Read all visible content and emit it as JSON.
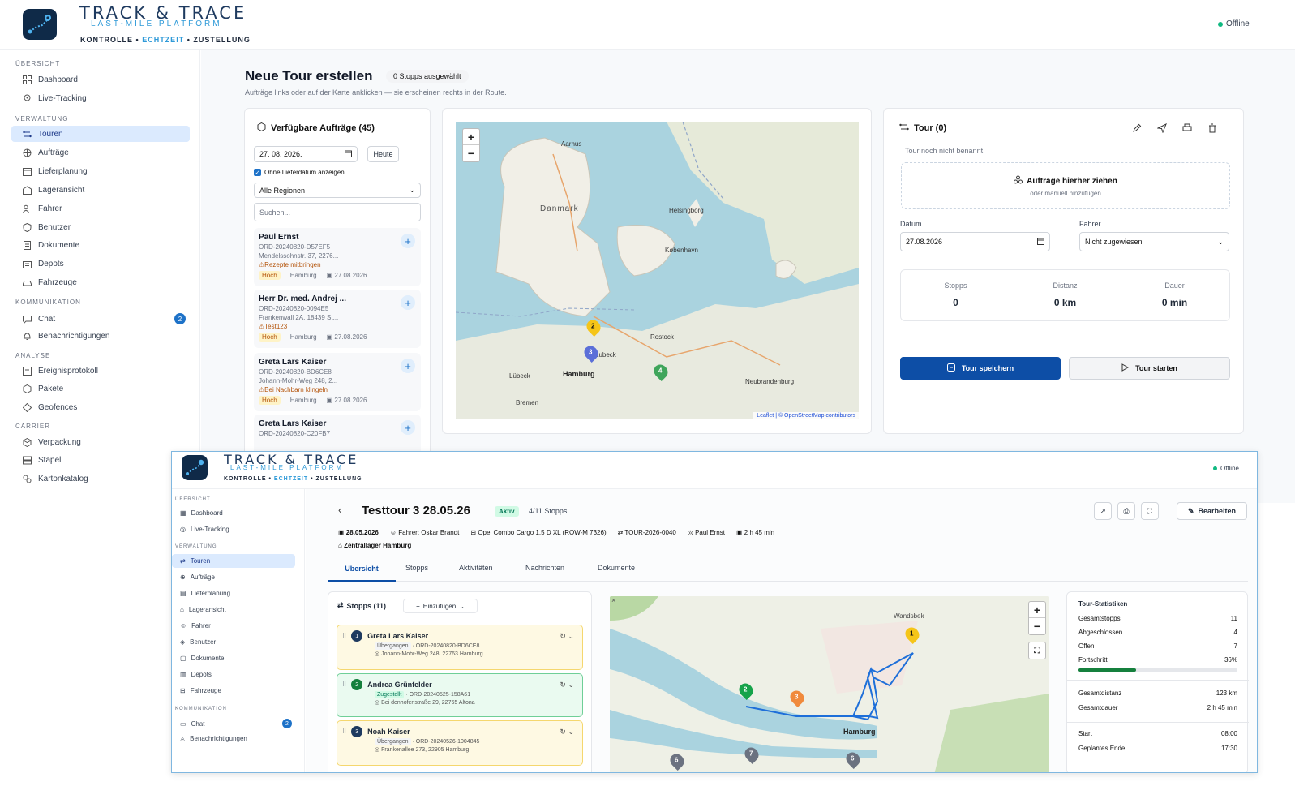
{
  "brand": {
    "title": "TRACK & TRACE",
    "subtitle": "LAST-MILE PLATFORM",
    "tag_a": "KONTROLLE",
    "tag_sep": "•",
    "tag_b": "ECHTZEIT",
    "tag_c": "ZUSTELLUNG"
  },
  "status": "Offline",
  "sidebar": {
    "sections": [
      "ÜBERSICHT",
      "VERWALTUNG",
      "KOMMUNIKATION",
      "ANALYSE",
      "CARRIER"
    ],
    "items": [
      "Dashboard",
      "Live-Tracking",
      "Touren",
      "Aufträge",
      "Lieferplanung",
      "Lageransicht",
      "Fahrer",
      "Benutzer",
      "Dokumente",
      "Depots",
      "Fahrzeuge",
      "Chat",
      "Benachrichtigungen",
      "Ereignisprotokoll",
      "Pakete",
      "Geofences",
      "Verpackung",
      "Stapel",
      "Kartonkatalog"
    ],
    "chat_badge": "2"
  },
  "page": {
    "title": "Neue Tour erstellen",
    "selected_pill": "0 Stopps ausgewählt",
    "hint": "Aufträge links oder auf der Karte anklicken — sie erscheinen rechts in der Route."
  },
  "orders": {
    "title": "Verfügbare Aufträge (45)",
    "date_value": "27. 08. 2026.",
    "today_label": "Heute",
    "checkbox_label": "Ohne Lieferdatum anzeigen",
    "region_value": "Alle Regionen",
    "search_placeholder": "Suchen...",
    "items": [
      {
        "name": "Paul Ernst",
        "id": "ORD-20240820-D57EF5",
        "address": "Mendelssohnstr. 37, 2276...",
        "note": "Rezepte mitbringen",
        "priority": "Hoch",
        "city": "Hamburg",
        "date": "27.08.2026"
      },
      {
        "name": "Herr Dr. med. Andrej ...",
        "id": "ORD-20240820-0094E5",
        "address": "Frankenwall 2A, 18439 St...",
        "note": "Test123",
        "priority": "Hoch",
        "city": "Hamburg",
        "date": "27.08.2026"
      },
      {
        "name": "Greta Lars Kaiser",
        "id": "ORD-20240820-BD6CE8",
        "address": "Johann-Mohr-Weg 248, 2...",
        "note": "Bei Nachbarn klingeln",
        "priority": "Hoch",
        "city": "Hamburg",
        "date": "27.08.2026"
      },
      {
        "name": "Greta Lars Kaiser",
        "id": "ORD-20240820-C20FB7",
        "address": "",
        "note": "",
        "priority": "",
        "city": "",
        "date": ""
      }
    ]
  },
  "map1": {
    "labels": [
      "Aarhus",
      "Danmark",
      "Helsingborg",
      "København",
      "Lübeck",
      "Hamburg",
      "Rostock",
      "Bremen",
      "Lubeck",
      "Neubrandenburg"
    ],
    "markers": [
      "2",
      "3",
      "4"
    ],
    "attribution": "Leaflet | © OpenStreetMap contributors"
  },
  "tour": {
    "title": "Tour (0)",
    "unnamed": "Tour noch nicht benannt",
    "drop_title": "Aufträge hierher ziehen",
    "drop_sub": "oder manuell hinzufügen",
    "date_label": "Datum",
    "date_value": "27.08.2026",
    "driver_label": "Fahrer",
    "driver_value": "Nicht zugewiesen",
    "stats": [
      {
        "label": "Stopps",
        "value": "0"
      },
      {
        "label": "Distanz",
        "value": "0 km"
      },
      {
        "label": "Dauer",
        "value": "0 min"
      }
    ],
    "save_label": "Tour speichern",
    "start_label": "Tour starten"
  },
  "detail": {
    "title": "Testtour 3 28.05.26",
    "status": "Aktiv",
    "stops_count": "4/11 Stopps",
    "edit_label": "Bearbeiten",
    "meta": {
      "date": "28.05.2026",
      "driver": "Fahrer: Oskar Brandt",
      "vehicle": "Opel Combo Cargo 1.5 D XL (ROW-M 7326)",
      "tour_id": "TOUR-2026-0040",
      "person": "Paul Ernst",
      "duration": "2 h 45 min",
      "depot": "Zentrallager Hamburg"
    },
    "tabs": [
      "Übersicht",
      "Stopps",
      "Aktivitäten",
      "Nachrichten",
      "Dokumente"
    ],
    "stops_title": "Stopps (11)",
    "add_label": "Hinzufügen",
    "stops": [
      {
        "num": "1",
        "name": "Greta Lars Kaiser",
        "state": "Übergangen",
        "id": "ORD-20240820-BD6CE8",
        "address": "Johann-Mohr-Weg 248, 22763 Hamburg"
      },
      {
        "num": "2",
        "name": "Andrea Grünfelder",
        "state": "Zugestellt",
        "id": "ORD-20240525-158A61",
        "address": "Bei denhofenstraße 29, 22765 Altona"
      },
      {
        "num": "3",
        "name": "Noah Kaiser",
        "state": "Übergangen",
        "id": "ORD-20240526-1004845",
        "address": "Frankenallee 273, 22905 Hamburg"
      }
    ],
    "map_labels": [
      "Wandsbek",
      "Hamburg"
    ],
    "map_markers": [
      "1",
      "2",
      "3",
      "6",
      "7",
      "6"
    ],
    "stats_title": "Tour-Statistiken",
    "stat_rows": [
      {
        "label": "Gesamtstopps",
        "value": "11"
      },
      {
        "label": "Abgeschlossen",
        "value": "4"
      },
      {
        "label": "Offen",
        "value": "7"
      },
      {
        "label": "Fortschritt",
        "value": "36%"
      }
    ],
    "progress": 0.36,
    "stat_rows2": [
      {
        "label": "Gesamtdistanz",
        "value": "123 km"
      },
      {
        "label": "Gesamtdauer",
        "value": "2 h 45 min"
      }
    ],
    "stat_rows3": [
      {
        "label": "Start",
        "value": "08:00"
      },
      {
        "label": "Geplantes Ende",
        "value": "17:30"
      }
    ]
  },
  "colors": {
    "primary": "#0d4ea6",
    "accent": "#2f9ad8",
    "online": "#10b981"
  }
}
